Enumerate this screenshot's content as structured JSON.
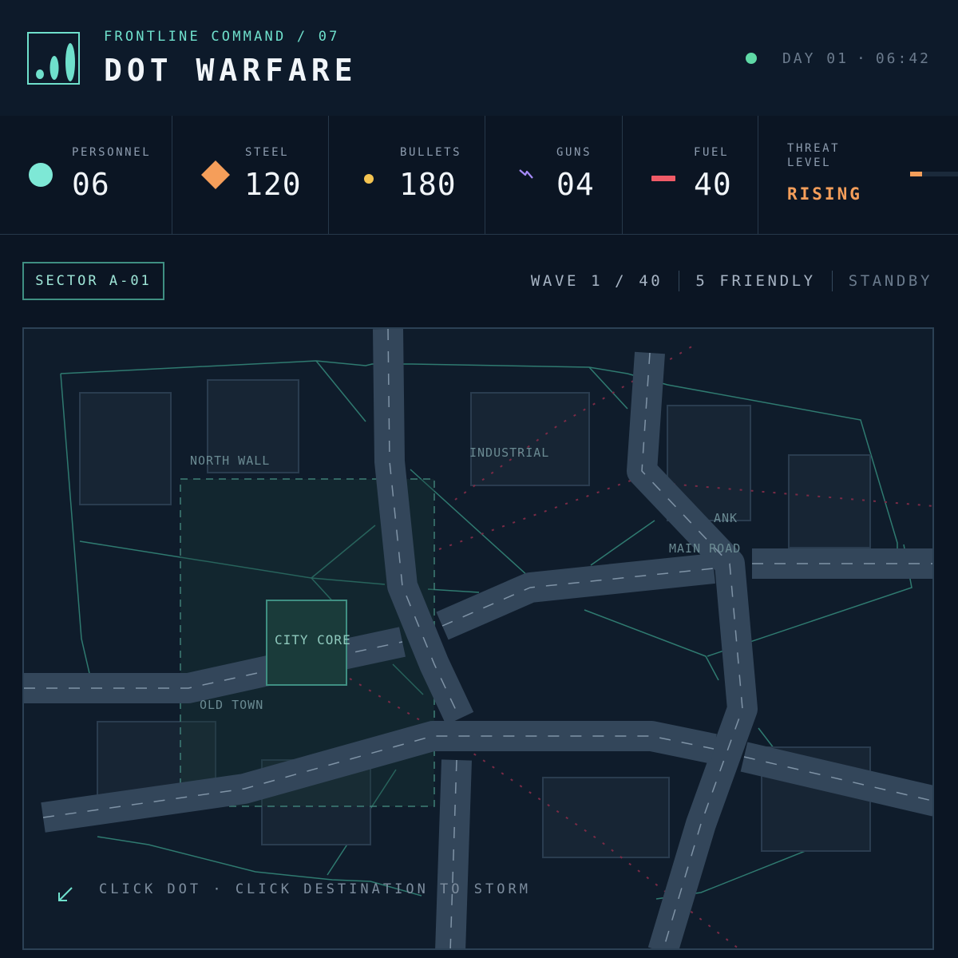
{
  "header": {
    "eyebrow": "FRONTLINE COMMAND / 07",
    "title": "DOT WARFARE",
    "day": "DAY 01",
    "time": "06:42",
    "status_color": "#5fd9a6"
  },
  "resources": [
    {
      "label": "PERSONNEL",
      "value": "06",
      "icon": "circle-icon",
      "color": "#7ee8d6"
    },
    {
      "label": "STEEL",
      "value": "120",
      "icon": "diamond-icon",
      "color": "#f59e5a"
    },
    {
      "label": "BULLETS",
      "value": "180",
      "icon": "bullet-dot-icon",
      "color": "#f5c451"
    },
    {
      "label": "GUNS",
      "value": "04",
      "icon": "lightning-icon",
      "color": "#a78bfa"
    },
    {
      "label": "FUEL",
      "value": "40",
      "icon": "fuel-bar-icon",
      "color": "#f05b67"
    }
  ],
  "threat": {
    "label_line1": "THREAT",
    "label_line2": "LEVEL",
    "value": "RISING",
    "level": 0.25,
    "color": "#f59e5a"
  },
  "sector": {
    "label": "SECTOR A-01"
  },
  "status": {
    "wave": "WAVE 1 / 40",
    "friendly": "5 FRIENDLY",
    "mode": "STANDBY"
  },
  "map": {
    "labels": {
      "north_wall": "NORTH WALL",
      "industrial": "INDUSTRIAL",
      "bank": "ANK",
      "main_road": "MAIN ROAD",
      "city_core": "CITY CORE",
      "old_town": "OLD TOWN"
    },
    "hint": "CLICK DOT · CLICK DESTINATION TO STORM",
    "colors": {
      "road": "#33465a",
      "grid_line": "#2f7a70",
      "block": "#1a2736"
    }
  }
}
